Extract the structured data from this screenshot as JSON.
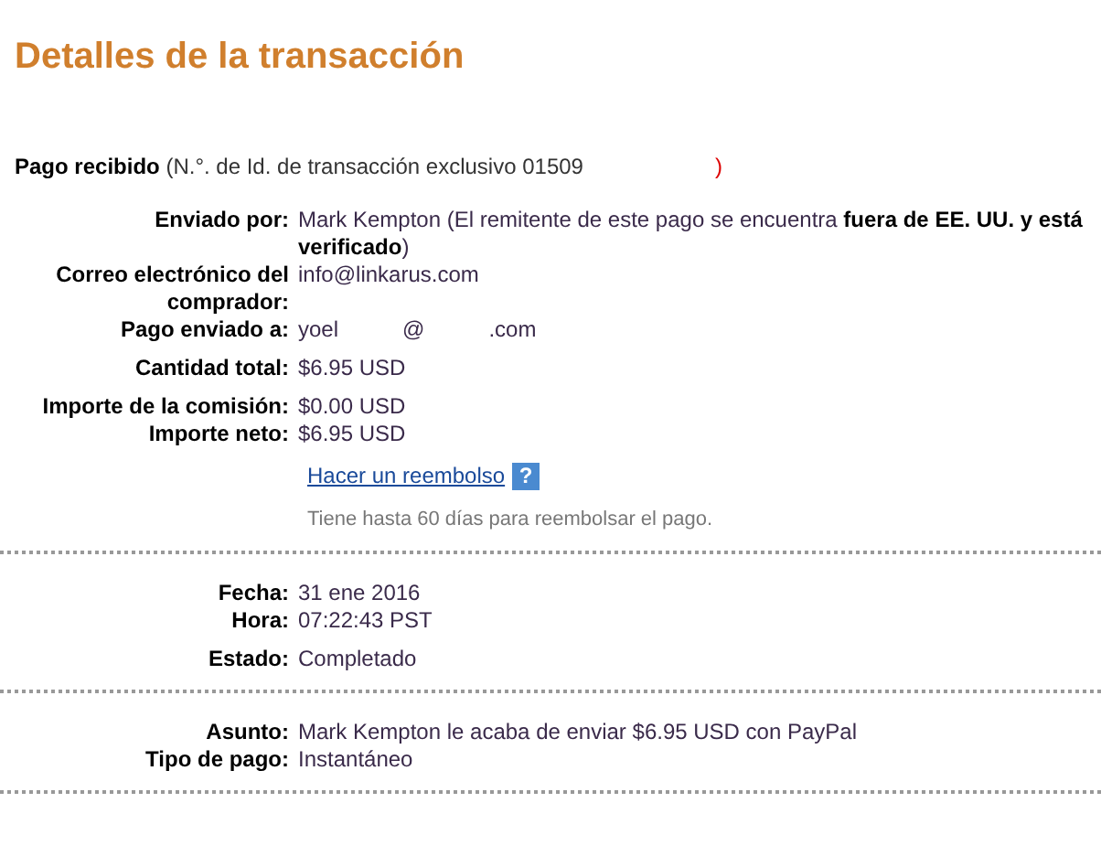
{
  "title": "Detalles de la transacción",
  "header": {
    "label": "Pago recibido",
    "note": "(N.°. de Id. de transacción exclusivo 01509",
    "note_end": ")"
  },
  "sections": [
    {
      "groups": [
        [
          {
            "label": "Enviado por:",
            "value": "Mark Kempton (El remitente de este pago se encuentra **fuera de EE. UU. y está verificado**)"
          },
          {
            "label": "Correo electrónico del comprador:",
            "value": "info@linkarus.com"
          },
          {
            "label": "Pago enviado a:",
            "parts": [
              "yoel",
              "@",
              ".com"
            ]
          }
        ],
        [
          {
            "label": "Cantidad total:",
            "value": "$6.95 USD"
          }
        ],
        [
          {
            "label": "Importe de la comisión:",
            "value": "$0.00 USD"
          },
          {
            "label": "Importe neto:",
            "value": "$6.95 USD"
          }
        ]
      ],
      "refund": {
        "link": "Hacer un reembolso",
        "help": "?",
        "note": "Tiene hasta 60 días para reembolsar el pago."
      }
    },
    {
      "groups": [
        [
          {
            "label": "Fecha:",
            "value": "31 ene 2016"
          },
          {
            "label": "Hora:",
            "value": "07:22:43 PST"
          }
        ],
        [
          {
            "label": "Estado:",
            "value": "Completado"
          }
        ]
      ]
    },
    {
      "groups": [
        [
          {
            "label": "Asunto:",
            "value": "Mark Kempton le acaba de enviar $6.95 USD con PayPal"
          },
          {
            "label": "Tipo de pago:",
            "value": "Instantáneo"
          }
        ]
      ]
    }
  ]
}
